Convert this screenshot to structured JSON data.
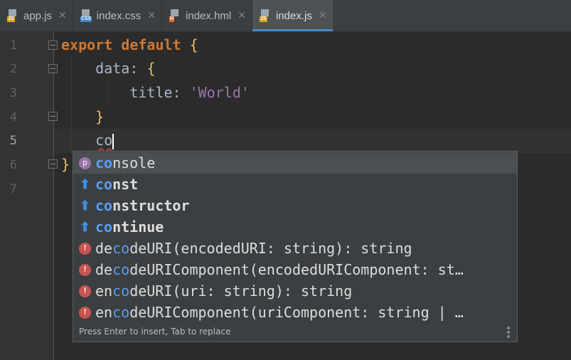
{
  "tabs": [
    {
      "label": "app.js",
      "badge": "JS",
      "badge_color": "#d8a325",
      "active": false
    },
    {
      "label": "index.css",
      "badge": "CSS",
      "badge_color": "#3e87c9",
      "active": false
    },
    {
      "label": "index.hml",
      "badge": "H",
      "badge_color": "#e0682e",
      "active": false
    },
    {
      "label": "index.js",
      "badge": "JS",
      "badge_color": "#d8a325",
      "active": true
    }
  ],
  "close_glyph": "✕",
  "line_numbers": [
    "1",
    "2",
    "3",
    "4",
    "5",
    "6",
    "7"
  ],
  "code": {
    "l1_kw": "export default",
    "l1_brace": "{",
    "l2_key": "data",
    "l2_colon": ":",
    "l2_brace": "{",
    "l3_key": "title",
    "l3_colon": ":",
    "l3_str": "'World'",
    "l4_brace": "}",
    "l5_typed": "co",
    "l6_brace": "}"
  },
  "completion": {
    "typed": "co",
    "items": [
      {
        "icon": "p",
        "kind": "property",
        "pre": "",
        "match": "co",
        "rest": "nsole",
        "bold": false,
        "selected": true
      },
      {
        "icon": "arrow",
        "kind": "keyword",
        "pre": "",
        "match": "co",
        "rest": "nst",
        "bold": true,
        "selected": false
      },
      {
        "icon": "arrow",
        "kind": "keyword",
        "pre": "",
        "match": "co",
        "rest": "nstructor",
        "bold": true,
        "selected": false
      },
      {
        "icon": "arrow",
        "kind": "keyword",
        "pre": "",
        "match": "co",
        "rest": "ntinue",
        "bold": true,
        "selected": false
      },
      {
        "icon": "f",
        "kind": "function",
        "pre": "de",
        "match": "co",
        "rest": "deURI(encodedURI: string): string",
        "bold": false,
        "selected": false
      },
      {
        "icon": "f",
        "kind": "function",
        "pre": "de",
        "match": "co",
        "rest": "deURIComponent(encodedURIComponent: st…",
        "bold": false,
        "selected": false
      },
      {
        "icon": "f",
        "kind": "function",
        "pre": "en",
        "match": "co",
        "rest": "deURI(uri: string): string",
        "bold": false,
        "selected": false
      },
      {
        "icon": "f",
        "kind": "function",
        "pre": "en",
        "match": "co",
        "rest": "deURIComponent(uriComponent: string | …",
        "bold": false,
        "selected": false
      }
    ],
    "footer": "Press Enter to insert, Tab to replace"
  }
}
